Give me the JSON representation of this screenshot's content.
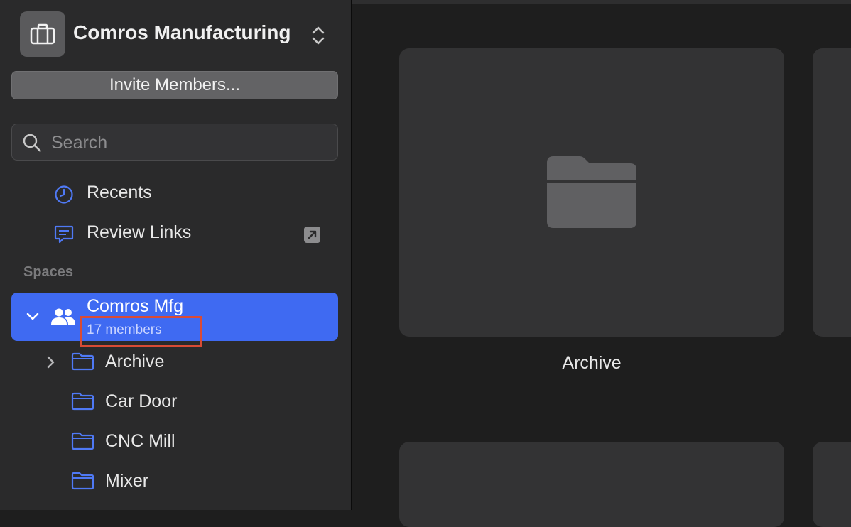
{
  "sidebar": {
    "workspace": {
      "name": "Comros Manufacturing",
      "icon": "briefcase-icon",
      "switch_icon": "chevron-up-down-icon"
    },
    "invite_label": "Invite Members...",
    "search": {
      "placeholder": "Search",
      "icon": "search-icon"
    },
    "nav": [
      {
        "label": "Recents",
        "icon": "clock-icon"
      },
      {
        "label": "Review Links",
        "icon": "speech-bubble-icon",
        "trailing_icon": "external-link-icon"
      }
    ],
    "spaces_header": "Spaces",
    "space": {
      "title": "Comros Mfg",
      "subtitle": "17 members",
      "icon": "people-icon",
      "expanded": true
    },
    "folders": [
      {
        "label": "Archive",
        "has_children": true
      },
      {
        "label": "Car Door",
        "has_children": false
      },
      {
        "label": "CNC Mill",
        "has_children": false
      },
      {
        "label": "Mixer",
        "has_children": false
      }
    ]
  },
  "main": {
    "tiles": [
      {
        "label": "Archive",
        "icon": "folder-icon"
      },
      {
        "label": ""
      },
      {
        "label": ""
      },
      {
        "label": ""
      }
    ]
  },
  "colors": {
    "accent": "#3f6af2",
    "highlight_box": "#d94b35",
    "sidebar_bg": "#2a2a2b",
    "main_bg": "#1e1e1e",
    "tile_bg": "#333334"
  }
}
